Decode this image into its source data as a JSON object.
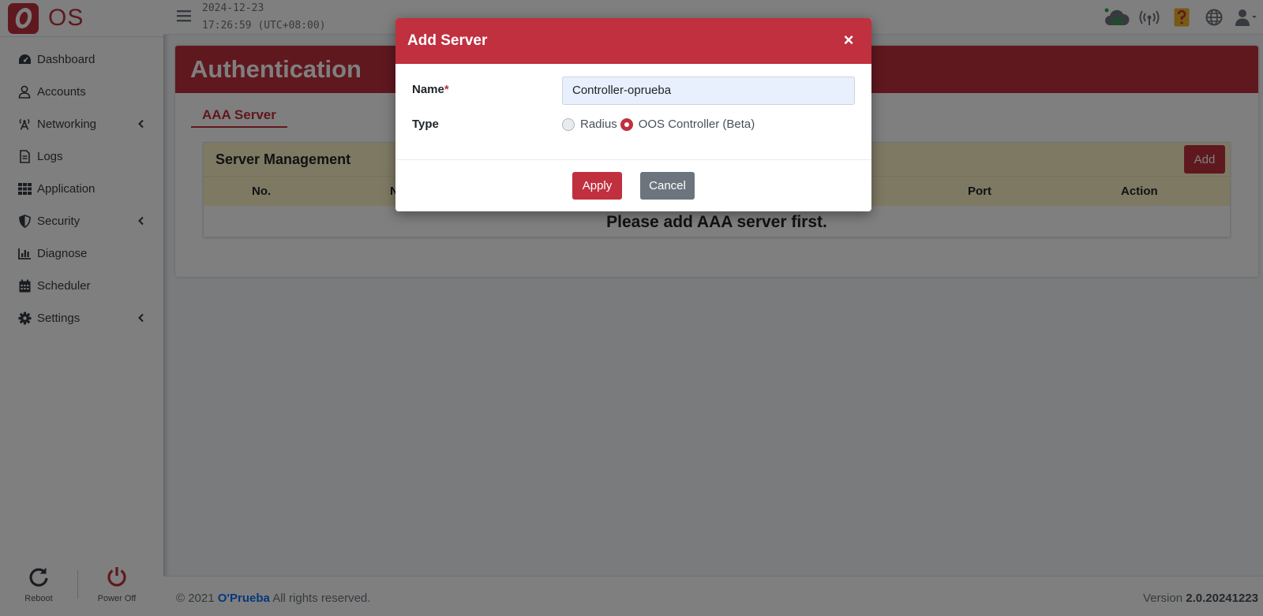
{
  "brand": {
    "name": "OS",
    "accent": "#c0303f"
  },
  "sidebar": {
    "items": [
      {
        "label": "Dashboard",
        "icon": "dashboard-icon"
      },
      {
        "label": "Accounts",
        "icon": "user-icon"
      },
      {
        "label": "Networking",
        "icon": "antenna-icon",
        "expandable": true
      },
      {
        "label": "Logs",
        "icon": "file-icon"
      },
      {
        "label": "Application",
        "icon": "grid-icon"
      },
      {
        "label": "Security",
        "icon": "shield-icon",
        "expandable": true
      },
      {
        "label": "Diagnose",
        "icon": "chart-icon"
      },
      {
        "label": "Scheduler",
        "icon": "calendar-icon"
      },
      {
        "label": "Settings",
        "icon": "gear-icon",
        "expandable": true
      }
    ],
    "reboot_label": "Reboot",
    "poweroff_label": "Power Off"
  },
  "topbar": {
    "date": "2024-12-23",
    "time": "17:26:59 (UTC+08:00)",
    "icons": [
      "cloud-status-icon",
      "wireless-icon",
      "help-icon",
      "globe-icon",
      "user-menu-icon"
    ]
  },
  "page": {
    "title": "Authentication",
    "tab": "AAA Server",
    "card_title": "Server Management",
    "add_label": "Add",
    "columns": [
      "No.",
      "N",
      "Port",
      "Action"
    ],
    "empty_message": "Please add AAA server first."
  },
  "footer": {
    "copyright": "© 2021",
    "company": "O'Prueba",
    "rights": "All rights reserved.",
    "version_label": "Version",
    "version": "2.0.20241223"
  },
  "modal": {
    "title": "Add Server",
    "close_glyph": "×",
    "name_label": "Name",
    "required_mark": "*",
    "name_value": "Controller-oprueba",
    "type_label": "Type",
    "type_options": [
      "Radius",
      "OOS Controller (Beta)"
    ],
    "type_selected": "OOS Controller (Beta)",
    "apply_label": "Apply",
    "cancel_label": "Cancel"
  }
}
